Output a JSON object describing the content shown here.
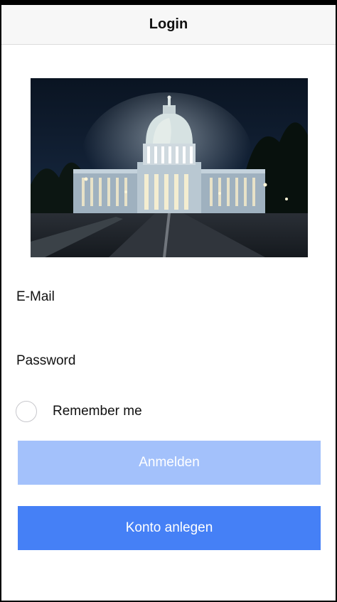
{
  "header": {
    "title": "Login"
  },
  "form": {
    "email_label": "E-Mail",
    "email_value": "",
    "password_label": "Password",
    "password_value": "",
    "remember_label": "Remember me",
    "remember_checked": false
  },
  "buttons": {
    "login_label": "Anmelden",
    "register_label": "Konto anlegen"
  },
  "colors": {
    "primary": "#4580f6",
    "primary_disabled": "#a3c1fb",
    "navbar_bg": "#f7f7f7"
  }
}
